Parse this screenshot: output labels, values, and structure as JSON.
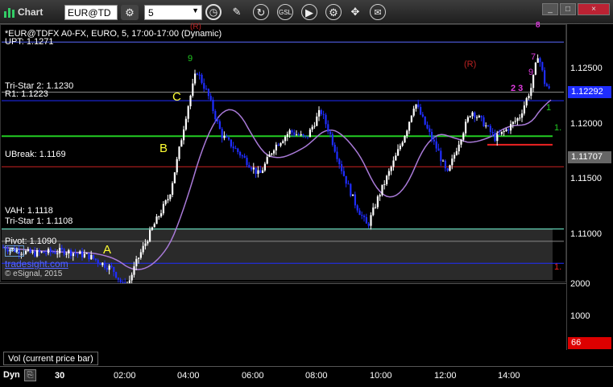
{
  "window": {
    "title": "Chart",
    "symbol": "EUR@TD",
    "interval": "5",
    "min_label": "_",
    "max_label": "□",
    "close_label": "×"
  },
  "toolbar": {
    "icons": [
      "clock-icon",
      "pencil-icon",
      "refresh-icon",
      "gsl-icon",
      "play-icon",
      "settings-icon",
      "cursor-icon",
      "chat-icon"
    ]
  },
  "chart": {
    "header": "*EUR@TDFX A0-FX, EURO, 5, 17:00-17:00 (Dynamic)",
    "header_r": "(R)",
    "level_labels": {
      "upt": "UPT: 1.1271",
      "tristar2": "Tri-Star 2: 1.1230",
      "r1": "R1: 1.1223",
      "ubreak": "UBreak: 1.1169",
      "vah": "VAH: 1.1118",
      "tristar1": "Tri-Star 1: 1.1108",
      "pivot": "Pivot: 1.1090"
    },
    "wave_labels": {
      "a": "A",
      "b": "B",
      "c": "C"
    },
    "r_marker": "(R)",
    "pc": "Pc",
    "watermark": "tradesight.com",
    "copyright": "© eSignal, 2015",
    "right_numbers": {
      "green": "1.",
      "red": "1."
    },
    "magenta_top": "8",
    "seq_magenta": "2 3",
    "seq_magenta_2": "9",
    "seq_magenta_3": "7",
    "count_green_1": "1",
    "count_green_9": "9",
    "color_bull": "#ffffff",
    "color_bear": "#1f2dff"
  },
  "price_axis": {
    "ticks": [
      "1.12500",
      "1.12000",
      "1.11500",
      "1.11000"
    ],
    "last_price": "1.12292",
    "ma_price": "1.11707"
  },
  "volume": {
    "label": "Vol (current price bar)",
    "ticks": [
      "2000",
      "1000"
    ],
    "current": "66"
  },
  "time_axis": {
    "mode": "Dyn",
    "ticks": [
      "30",
      "02:00",
      "04:00",
      "06:00",
      "08:00",
      "10:00",
      "12:00",
      "14:00"
    ]
  },
  "chart_data": {
    "type": "candlestick",
    "title": "*EUR@TDFX A0-FX, EURO, 5, 17:00-17:00 (Dynamic)",
    "ylim": [
      1.1075,
      1.1285
    ],
    "levels": [
      {
        "name": "UPT",
        "value": 1.1271
      },
      {
        "name": "Tri-Star 2",
        "value": 1.123
      },
      {
        "name": "R1",
        "value": 1.1223
      },
      {
        "name": "UBreak",
        "value": 1.1169
      },
      {
        "name": "VAH",
        "value": 1.1118
      },
      {
        "name": "Tri-Star 1",
        "value": 1.1108
      },
      {
        "name": "Pivot",
        "value": 1.109
      }
    ],
    "last_price": 1.12292,
    "ma_value": 1.11707,
    "volume_current": 66,
    "volume_ylim": [
      0,
      2500
    ]
  }
}
